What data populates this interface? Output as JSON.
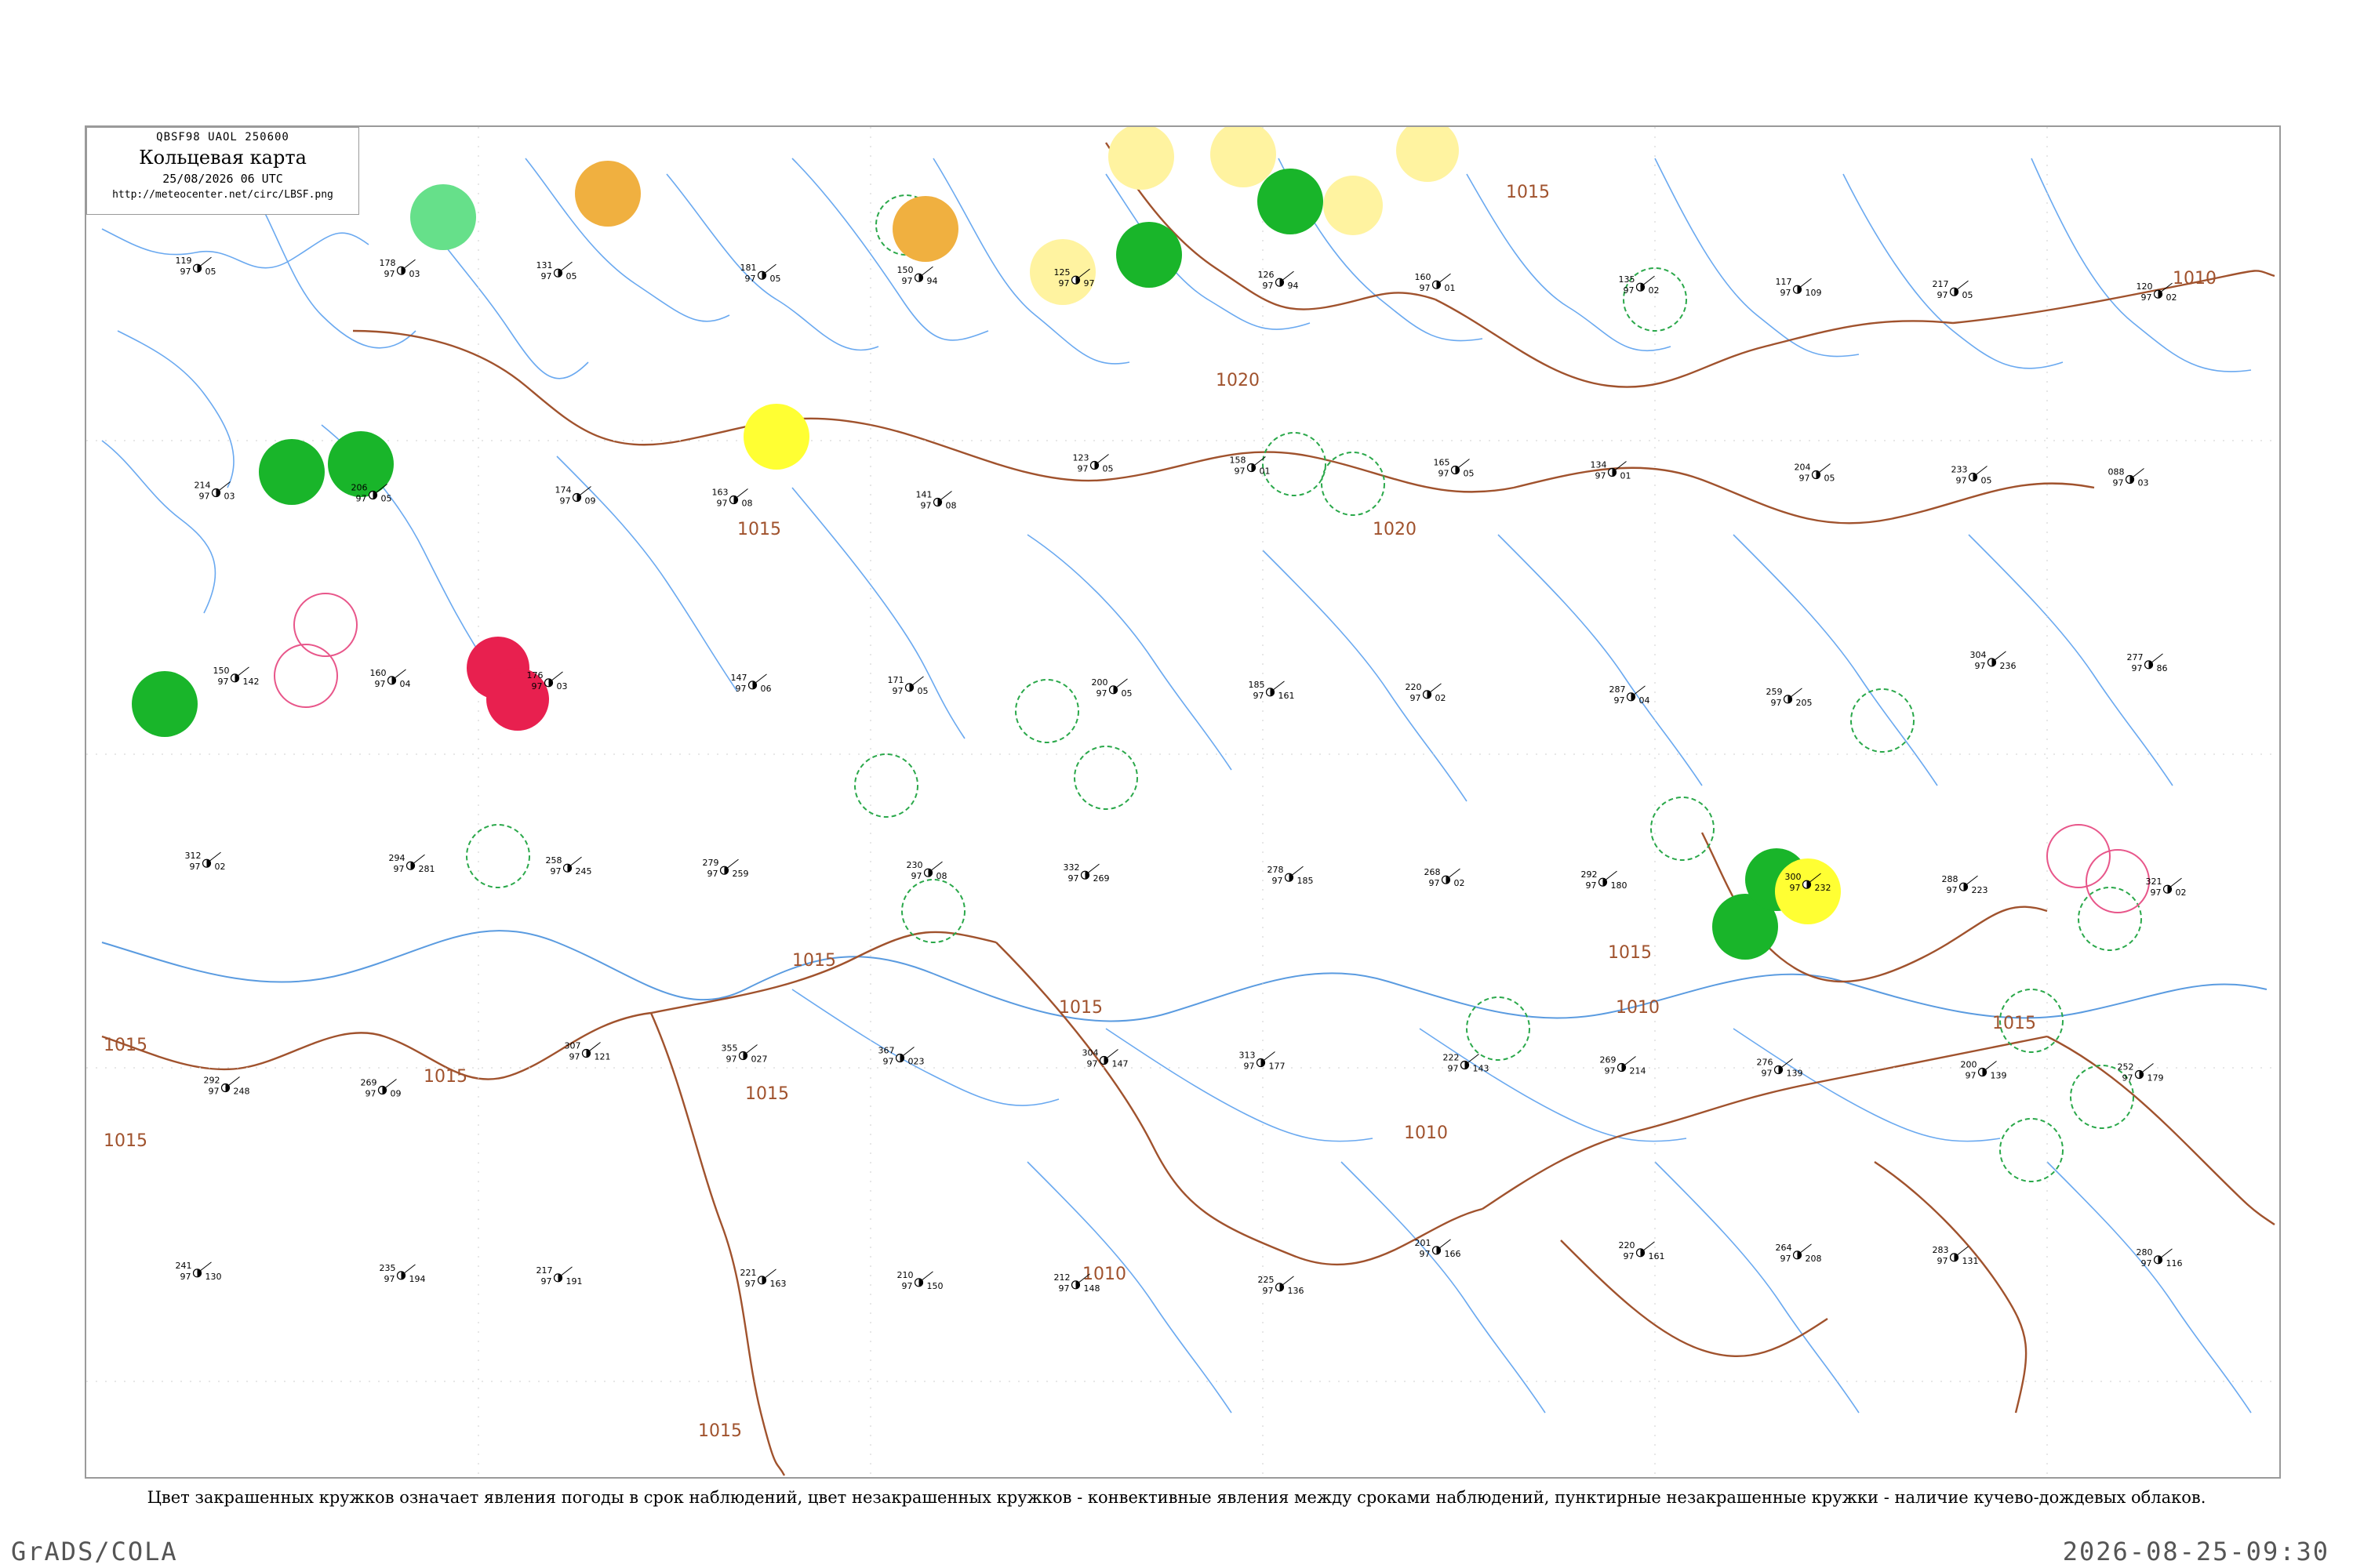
{
  "header": {
    "code": "QBSF98  UAOL  250600",
    "title": "Кольцевая карта",
    "datetime": "25/08/2026 06 UTC",
    "url": "http://meteocenter.net/circ/LBSF.png"
  },
  "footnote": "Цвет закрашенных кружков означает явления погоды в срок наблюдений, цвет незакрашенных кружков - конвективные явления между сроками наблюдений, пунктирные незакрашенные кружки - наличие кучево-дождевых облаков.",
  "footer": {
    "left": "GrADS/COLA",
    "right": "2026-08-25-09:30"
  },
  "colors": {
    "isobar": "#a0522d",
    "river": "#6aa9f0",
    "coast": "#5a9be0",
    "station_text": "#000000",
    "thunderstorm": "#e8204f",
    "rain": "#19b52a",
    "light_rain": "#66e08a",
    "fog": "#f0b040",
    "haze": "#ffff33",
    "pale_haze": "#fff3a0",
    "cb_dashed": "#2aa84a",
    "past_storm": "#e8568a"
  },
  "isobar_labels": [
    "1015",
    "1015",
    "1015",
    "1015",
    "1015",
    "1015",
    "1015",
    "1015",
    "1015",
    "1010",
    "1010",
    "1010",
    "1020",
    "1020",
    "1015",
    "1015",
    "1010"
  ],
  "filled_circles": [
    {
      "type": "thunderstorm",
      "station": "41"
    },
    {
      "type": "thunderstorm",
      "station": "24"
    },
    {
      "type": "rain",
      "station": "120"
    },
    {
      "type": "rain",
      "station": "121"
    },
    {
      "type": "rain",
      "station": "251"
    },
    {
      "type": "rain",
      "station": "111"
    },
    {
      "type": "rain",
      "station": "97"
    },
    {
      "type": "rain",
      "station": "254"
    },
    {
      "type": "light_rain",
      "station": "81"
    },
    {
      "type": "fog",
      "station": "122"
    },
    {
      "type": "fog",
      "station": "111"
    },
    {
      "type": "haze",
      "station": "98"
    },
    {
      "type": "haze",
      "station": "150"
    },
    {
      "type": "pale_haze",
      "station": "119"
    },
    {
      "type": "pale_haze",
      "station": "128"
    },
    {
      "type": "pale_haze",
      "station": "124"
    },
    {
      "type": "pale_haze",
      "station": "121"
    },
    {
      "type": "pale_haze",
      "station": "165"
    }
  ],
  "stations": [
    {
      "t": "119",
      "td": "97",
      "p": "05"
    },
    {
      "t": "178",
      "td": "97",
      "p": "03"
    },
    {
      "t": "131",
      "td": "97",
      "p": "05"
    },
    {
      "t": "181",
      "td": "97",
      "p": "05"
    },
    {
      "t": "150",
      "td": "97",
      "p": "94"
    },
    {
      "t": "125",
      "td": "97",
      "p": "97"
    },
    {
      "t": "126",
      "td": "97",
      "p": "94"
    },
    {
      "t": "160",
      "td": "97",
      "p": "01"
    },
    {
      "t": "135",
      "td": "97",
      "p": "02"
    },
    {
      "t": "117",
      "td": "97",
      "p": "109"
    },
    {
      "t": "217",
      "td": "97",
      "p": "05"
    },
    {
      "t": "120",
      "td": "97",
      "p": "02"
    },
    {
      "t": "214",
      "td": "97",
      "p": "03"
    },
    {
      "t": "206",
      "td": "97",
      "p": "05"
    },
    {
      "t": "174",
      "td": "97",
      "p": "09"
    },
    {
      "t": "163",
      "td": "97",
      "p": "08"
    },
    {
      "t": "141",
      "td": "97",
      "p": "08"
    },
    {
      "t": "123",
      "td": "97",
      "p": "05"
    },
    {
      "t": "158",
      "td": "97",
      "p": "01"
    },
    {
      "t": "165",
      "td": "97",
      "p": "05"
    },
    {
      "t": "134",
      "td": "97",
      "p": "01"
    },
    {
      "t": "204",
      "td": "97",
      "p": "05"
    },
    {
      "t": "233",
      "td": "97",
      "p": "05"
    },
    {
      "t": "088",
      "td": "97",
      "p": "03"
    },
    {
      "t": "150",
      "td": "97",
      "p": "142"
    },
    {
      "t": "160",
      "td": "97",
      "p": "04"
    },
    {
      "t": "176",
      "td": "97",
      "p": "03"
    },
    {
      "t": "147",
      "td": "97",
      "p": "06"
    },
    {
      "t": "171",
      "td": "97",
      "p": "05"
    },
    {
      "t": "200",
      "td": "97",
      "p": "05"
    },
    {
      "t": "185",
      "td": "97",
      "p": "161"
    },
    {
      "t": "220",
      "td": "97",
      "p": "02"
    },
    {
      "t": "287",
      "td": "97",
      "p": "04"
    },
    {
      "t": "259",
      "td": "97",
      "p": "205"
    },
    {
      "t": "304",
      "td": "97",
      "p": "236"
    },
    {
      "t": "277",
      "td": "97",
      "p": "86"
    },
    {
      "t": "312",
      "td": "97",
      "p": "02"
    },
    {
      "t": "294",
      "td": "97",
      "p": "281"
    },
    {
      "t": "258",
      "td": "97",
      "p": "245"
    },
    {
      "t": "279",
      "td": "97",
      "p": "259"
    },
    {
      "t": "230",
      "td": "97",
      "p": "08"
    },
    {
      "t": "332",
      "td": "97",
      "p": "269"
    },
    {
      "t": "278",
      "td": "97",
      "p": "185"
    },
    {
      "t": "268",
      "td": "97",
      "p": "02"
    },
    {
      "t": "292",
      "td": "97",
      "p": "180"
    },
    {
      "t": "300",
      "td": "97",
      "p": "232"
    },
    {
      "t": "288",
      "td": "97",
      "p": "223"
    },
    {
      "t": "321",
      "td": "97",
      "p": "02"
    },
    {
      "t": "292",
      "td": "97",
      "p": "248"
    },
    {
      "t": "269",
      "td": "97",
      "p": "09"
    },
    {
      "t": "307",
      "td": "97",
      "p": "121"
    },
    {
      "t": "355",
      "td": "97",
      "p": "027"
    },
    {
      "t": "367",
      "td": "97",
      "p": "023"
    },
    {
      "t": "304",
      "td": "97",
      "p": "147"
    },
    {
      "t": "313",
      "td": "97",
      "p": "177"
    },
    {
      "t": "222",
      "td": "97",
      "p": "143"
    },
    {
      "t": "269",
      "td": "97",
      "p": "214"
    },
    {
      "t": "276",
      "td": "97",
      "p": "139"
    },
    {
      "t": "200",
      "td": "97",
      "p": "139"
    },
    {
      "t": "252",
      "td": "97",
      "p": "179"
    },
    {
      "t": "241",
      "td": "97",
      "p": "130"
    },
    {
      "t": "235",
      "td": "97",
      "p": "194"
    },
    {
      "t": "217",
      "td": "97",
      "p": "191"
    },
    {
      "t": "221",
      "td": "97",
      "p": "163"
    },
    {
      "t": "210",
      "td": "97",
      "p": "150"
    },
    {
      "t": "212",
      "td": "97",
      "p": "148"
    },
    {
      "t": "225",
      "td": "97",
      "p": "136"
    },
    {
      "t": "201",
      "td": "97",
      "p": "166"
    },
    {
      "t": "220",
      "td": "97",
      "p": "161"
    },
    {
      "t": "264",
      "td": "97",
      "p": "208"
    },
    {
      "t": "283",
      "td": "97",
      "p": "131"
    },
    {
      "t": "280",
      "td": "97",
      "p": "116"
    }
  ]
}
